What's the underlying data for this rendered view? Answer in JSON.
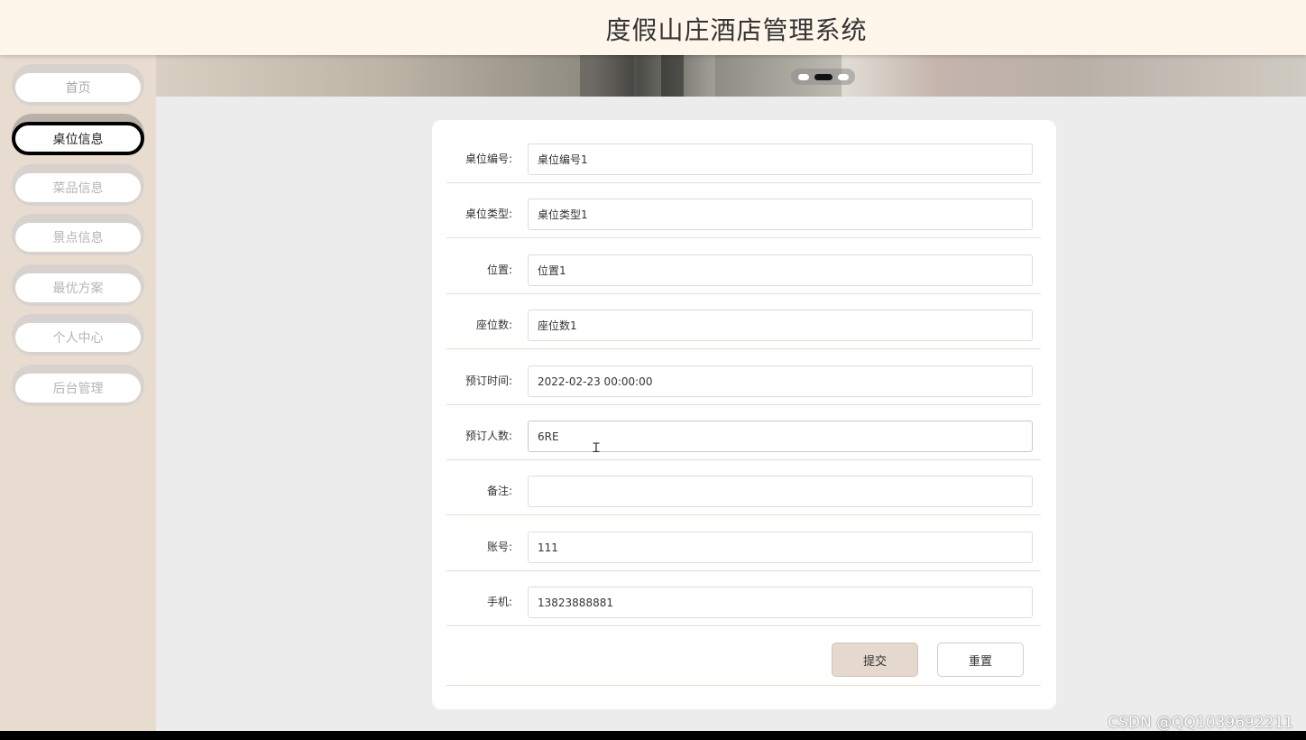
{
  "header": {
    "title": "度假山庄酒店管理系统"
  },
  "sidebar": {
    "items": [
      {
        "label": "首页"
      },
      {
        "label": "桌位信息"
      },
      {
        "label": "菜品信息"
      },
      {
        "label": "景点信息"
      },
      {
        "label": "最优方案"
      },
      {
        "label": "个人中心"
      },
      {
        "label": "后台管理"
      }
    ],
    "active_index": 1
  },
  "carousel": {
    "slides": 3,
    "active_index": 1
  },
  "form": {
    "fields": [
      {
        "label": "桌位编号:",
        "value": "桌位编号1"
      },
      {
        "label": "桌位类型:",
        "value": "桌位类型1"
      },
      {
        "label": "位置:",
        "value": "位置1"
      },
      {
        "label": "座位数:",
        "value": "座位数1"
      },
      {
        "label": "预订时间:",
        "value": "2022-02-23 00:00:00"
      },
      {
        "label": "预订人数:",
        "value": "6RE"
      },
      {
        "label": "备注:",
        "value": ""
      },
      {
        "label": "账号:",
        "value": "111"
      },
      {
        "label": "手机:",
        "value": "13823888881"
      }
    ],
    "submit_label": "提交",
    "reset_label": "重置"
  },
  "watermark": "CSDN @QQ1039692211",
  "colors": {
    "header_bg": "#fef6ea",
    "sidebar_bg": "#e8dcd1",
    "submit_bg": "#e5d8cc",
    "row_divider": "#ecdccd"
  }
}
